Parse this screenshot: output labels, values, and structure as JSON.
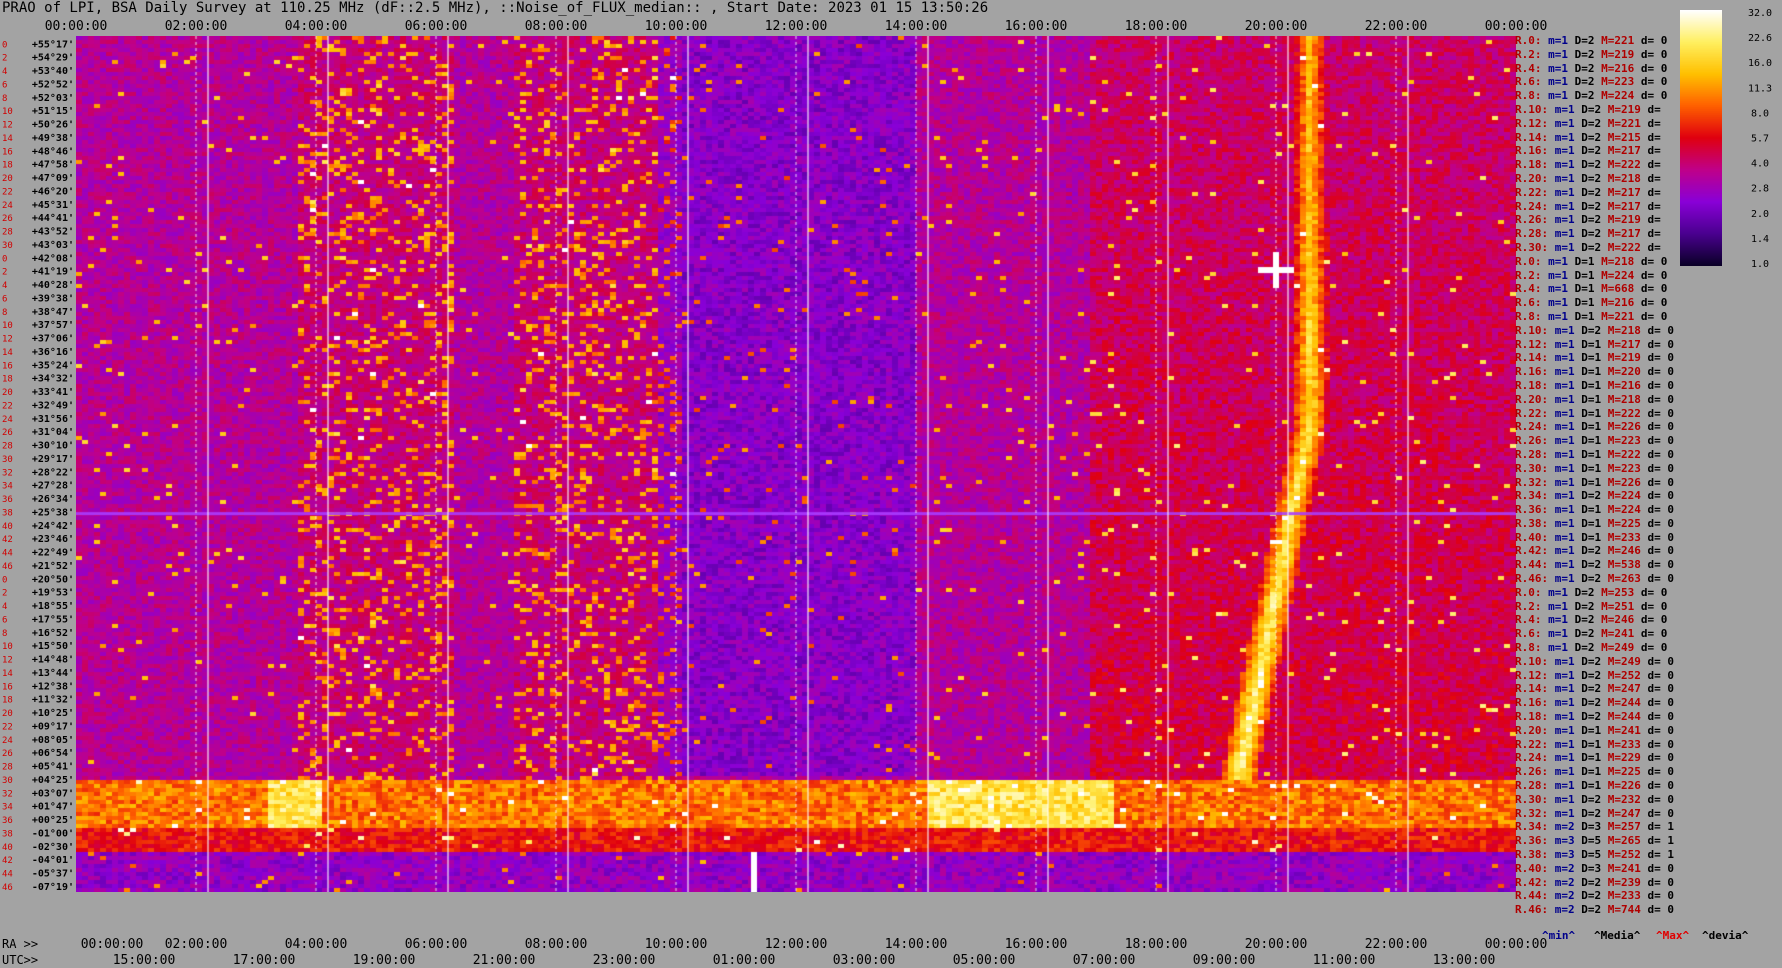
{
  "title": "PRAO of LPI, BSA Daily Survey at 110.25 MHz (dF::2.5 MHz), ::Noise_of_FLUX_median:: , Start Date: 2023 01 15 13:50:26",
  "axis": {
    "top_ticks": [
      "00:00:00",
      "02:00:00",
      "04:00:00",
      "06:00:00",
      "08:00:00",
      "10:00:00",
      "12:00:00",
      "14:00:00",
      "16:00:00",
      "18:00:00",
      "20:00:00",
      "22:00:00",
      "00:00:00"
    ],
    "ra_label": "RA >>",
    "ra_ticks": [
      "00:00:00",
      "02:00:00",
      "04:00:00",
      "06:00:00",
      "08:00:00",
      "10:00:00",
      "12:00:00",
      "14:00:00",
      "16:00:00",
      "18:00:00",
      "20:00:00",
      "22:00:00",
      "00:00:00"
    ],
    "utc_label": "UTC>>",
    "utc_ticks": [
      "15:00:00",
      "17:00:00",
      "19:00:00",
      "21:00:00",
      "23:00:00",
      "01:00:00",
      "03:00:00",
      "05:00:00",
      "07:00:00",
      "09:00:00",
      "11:00:00",
      "13:00:00"
    ],
    "row_index": [
      "0",
      "2",
      "4",
      "6",
      "8",
      "10",
      "12",
      "14",
      "16",
      "18",
      "20",
      "22",
      "24",
      "26",
      "28",
      "30",
      "0",
      "2",
      "4",
      "6",
      "8",
      "10",
      "12",
      "14",
      "16",
      "18",
      "20",
      "22",
      "24",
      "26",
      "28",
      "30",
      "32",
      "34",
      "36",
      "38",
      "40",
      "42",
      "44",
      "46",
      "0",
      "2",
      "4",
      "6",
      "8",
      "10",
      "12",
      "14",
      "16",
      "18",
      "20",
      "22",
      "24",
      "26",
      "28",
      "30",
      "32",
      "34",
      "36",
      "38",
      "40",
      "42",
      "44",
      "46"
    ],
    "dec_labels": [
      "+55°17'",
      "+54°29'",
      "+53°40'",
      "+52°52'",
      "+52°03'",
      "+51°15'",
      "+50°26'",
      "+49°38'",
      "+48°46'",
      "+47°58'",
      "+47°09'",
      "+46°20'",
      "+45°31'",
      "+44°41'",
      "+43°52'",
      "+43°03'",
      "+42°08'",
      "+41°19'",
      "+40°28'",
      "+39°38'",
      "+38°47'",
      "+37°57'",
      "+37°06'",
      "+36°16'",
      "+35°24'",
      "+34°32'",
      "+33°41'",
      "+32°49'",
      "+31°56'",
      "+31°04'",
      "+30°10'",
      "+29°17'",
      "+28°22'",
      "+27°28'",
      "+26°34'",
      "+25°38'",
      "+24°42'",
      "+23°46'",
      "+22°49'",
      "+21°52'",
      "+20°50'",
      "+19°53'",
      "+18°55'",
      "+17°55'",
      "+16°52'",
      "+15°50'",
      "+14°48'",
      "+13°44'",
      "+12°38'",
      "+11°32'",
      "+10°25'",
      "+09°17'",
      "+08°05'",
      "+06°54'",
      "+05°41'",
      "+04°25'",
      "+03°07'",
      "+01°47'",
      "+00°25'",
      "-01°00'",
      "-02°30'",
      "-04°01'",
      "-05°37'",
      "-07°19'"
    ]
  },
  "colorbar": {
    "ticks": [
      "32.0",
      "22.6",
      "16.0",
      "11.3",
      "8.0",
      "5.7",
      "4.0",
      "2.8",
      "2.0",
      "1.4",
      "1.0"
    ],
    "colors": [
      "#ffffff",
      "#fff060",
      "#ffc000",
      "#ff6000",
      "#e00010",
      "#c0008a",
      "#8a00d8",
      "#4a0090",
      "#0c0028"
    ]
  },
  "stats": [
    {
      "r": "R.0:",
      "m": "1",
      "D": "2",
      "M": "221",
      "d": "0"
    },
    {
      "r": "R.2:",
      "m": "1",
      "D": "2",
      "M": "219",
      "d": "0"
    },
    {
      "r": "R.4:",
      "m": "1",
      "D": "2",
      "M": "216",
      "d": "0"
    },
    {
      "r": "R.6:",
      "m": "1",
      "D": "2",
      "M": "223",
      "d": "0"
    },
    {
      "r": "R.8:",
      "m": "1",
      "D": "2",
      "M": "224",
      "d": "0"
    },
    {
      "r": "R.10:",
      "m": "1",
      "D": "2",
      "M": "219",
      "d": ""
    },
    {
      "r": "R.12:",
      "m": "1",
      "D": "2",
      "M": "221",
      "d": ""
    },
    {
      "r": "R.14:",
      "m": "1",
      "D": "2",
      "M": "215",
      "d": ""
    },
    {
      "r": "R.16:",
      "m": "1",
      "D": "2",
      "M": "217",
      "d": ""
    },
    {
      "r": "R.18:",
      "m": "1",
      "D": "2",
      "M": "222",
      "d": ""
    },
    {
      "r": "R.20:",
      "m": "1",
      "D": "2",
      "M": "218",
      "d": ""
    },
    {
      "r": "R.22:",
      "m": "1",
      "D": "2",
      "M": "217",
      "d": ""
    },
    {
      "r": "R.24:",
      "m": "1",
      "D": "2",
      "M": "217",
      "d": ""
    },
    {
      "r": "R.26:",
      "m": "1",
      "D": "2",
      "M": "219",
      "d": ""
    },
    {
      "r": "R.28:",
      "m": "1",
      "D": "2",
      "M": "217",
      "d": ""
    },
    {
      "r": "R.30:",
      "m": "1",
      "D": "2",
      "M": "222",
      "d": ""
    },
    {
      "r": "R.0:",
      "m": "1",
      "D": "1",
      "M": "218",
      "d": "0"
    },
    {
      "r": "R.2:",
      "m": "1",
      "D": "1",
      "M": "224",
      "d": "0"
    },
    {
      "r": "R.4:",
      "m": "1",
      "D": "1",
      "M": "668",
      "d": "0"
    },
    {
      "r": "R.6:",
      "m": "1",
      "D": "1",
      "M": "216",
      "d": "0"
    },
    {
      "r": "R.8:",
      "m": "1",
      "D": "1",
      "M": "221",
      "d": "0"
    },
    {
      "r": "R.10:",
      "m": "1",
      "D": "2",
      "M": "218",
      "d": "0"
    },
    {
      "r": "R.12:",
      "m": "1",
      "D": "1",
      "M": "217",
      "d": "0"
    },
    {
      "r": "R.14:",
      "m": "1",
      "D": "1",
      "M": "219",
      "d": "0"
    },
    {
      "r": "R.16:",
      "m": "1",
      "D": "1",
      "M": "220",
      "d": "0"
    },
    {
      "r": "R.18:",
      "m": "1",
      "D": "1",
      "M": "216",
      "d": "0"
    },
    {
      "r": "R.20:",
      "m": "1",
      "D": "1",
      "M": "218",
      "d": "0"
    },
    {
      "r": "R.22:",
      "m": "1",
      "D": "1",
      "M": "222",
      "d": "0"
    },
    {
      "r": "R.24:",
      "m": "1",
      "D": "1",
      "M": "226",
      "d": "0"
    },
    {
      "r": "R.26:",
      "m": "1",
      "D": "1",
      "M": "223",
      "d": "0"
    },
    {
      "r": "R.28:",
      "m": "1",
      "D": "1",
      "M": "222",
      "d": "0"
    },
    {
      "r": "R.30:",
      "m": "1",
      "D": "1",
      "M": "223",
      "d": "0"
    },
    {
      "r": "R.32:",
      "m": "1",
      "D": "1",
      "M": "226",
      "d": "0"
    },
    {
      "r": "R.34:",
      "m": "1",
      "D": "2",
      "M": "224",
      "d": "0"
    },
    {
      "r": "R.36:",
      "m": "1",
      "D": "1",
      "M": "224",
      "d": "0"
    },
    {
      "r": "R.38:",
      "m": "1",
      "D": "1",
      "M": "225",
      "d": "0"
    },
    {
      "r": "R.40:",
      "m": "1",
      "D": "1",
      "M": "233",
      "d": "0"
    },
    {
      "r": "R.42:",
      "m": "1",
      "D": "2",
      "M": "246",
      "d": "0"
    },
    {
      "r": "R.44:",
      "m": "1",
      "D": "2",
      "M": "538",
      "d": "0"
    },
    {
      "r": "R.46:",
      "m": "1",
      "D": "2",
      "M": "263",
      "d": "0"
    },
    {
      "r": "R.0:",
      "m": "1",
      "D": "2",
      "M": "253",
      "d": "0"
    },
    {
      "r": "R.2:",
      "m": "1",
      "D": "2",
      "M": "251",
      "d": "0"
    },
    {
      "r": "R.4:",
      "m": "1",
      "D": "2",
      "M": "246",
      "d": "0"
    },
    {
      "r": "R.6:",
      "m": "1",
      "D": "2",
      "M": "241",
      "d": "0"
    },
    {
      "r": "R.8:",
      "m": "1",
      "D": "2",
      "M": "249",
      "d": "0"
    },
    {
      "r": "R.10:",
      "m": "1",
      "D": "2",
      "M": "249",
      "d": "0"
    },
    {
      "r": "R.12:",
      "m": "1",
      "D": "2",
      "M": "252",
      "d": "0"
    },
    {
      "r": "R.14:",
      "m": "1",
      "D": "2",
      "M": "247",
      "d": "0"
    },
    {
      "r": "R.16:",
      "m": "1",
      "D": "2",
      "M": "244",
      "d": "0"
    },
    {
      "r": "R.18:",
      "m": "1",
      "D": "2",
      "M": "244",
      "d": "0"
    },
    {
      "r": "R.20:",
      "m": "1",
      "D": "1",
      "M": "241",
      "d": "0"
    },
    {
      "r": "R.22:",
      "m": "1",
      "D": "1",
      "M": "233",
      "d": "0"
    },
    {
      "r": "R.24:",
      "m": "1",
      "D": "1",
      "M": "229",
      "d": "0"
    },
    {
      "r": "R.26:",
      "m": "1",
      "D": "1",
      "M": "225",
      "d": "0"
    },
    {
      "r": "R.28:",
      "m": "1",
      "D": "1",
      "M": "226",
      "d": "0"
    },
    {
      "r": "R.30:",
      "m": "1",
      "D": "2",
      "M": "232",
      "d": "0"
    },
    {
      "r": "R.32:",
      "m": "1",
      "D": "2",
      "M": "247",
      "d": "0"
    },
    {
      "r": "R.34:",
      "m": "2",
      "D": "3",
      "M": "257",
      "d": "1"
    },
    {
      "r": "R.36:",
      "m": "3",
      "D": "5",
      "M": "265",
      "d": "1"
    },
    {
      "r": "R.38:",
      "m": "3",
      "D": "5",
      "M": "252",
      "d": "1"
    },
    {
      "r": "R.40:",
      "m": "2",
      "D": "3",
      "M": "241",
      "d": "0"
    },
    {
      "r": "R.42:",
      "m": "2",
      "D": "2",
      "M": "239",
      "d": "0"
    },
    {
      "r": "R.44:",
      "m": "2",
      "D": "2",
      "M": "233",
      "d": "0"
    },
    {
      "r": "R.46:",
      "m": "2",
      "D": "2",
      "M": "744",
      "d": "0"
    }
  ],
  "bottom_legend": {
    "min": "^min^",
    "median": "^Media^",
    "max": "^Max^",
    "dev": "^devia^"
  },
  "chart_data": {
    "type": "heatmap",
    "title": "PRAO of LPI, BSA Daily Survey at 110.25 MHz (dF::2.5 MHz), ::Noise_of_FLUX_median:: , Start Date: 2023 01 15 13:50:26",
    "x_axis_top": "RA 00:00:00 to 24:00:00",
    "y_axis": "Declination +55°17' to -07°19'",
    "color_scale": [
      1.0,
      32.0
    ],
    "log_scale": true,
    "features": [
      {
        "desc": "bright horizontal interference band",
        "dec": [
          "+01°47'",
          "-02°30'"
        ],
        "level": 8
      },
      {
        "desc": "strong point source",
        "ra": "20:00:00",
        "dec": "+41°19'",
        "level": 32
      },
      {
        "desc": "Galactic plane ridge",
        "ra": [
          "18:00:00",
          "20:10:00"
        ],
        "level": 8
      },
      {
        "desc": "horizontal artifact line",
        "dec": "+25°38'",
        "level": 2.8
      }
    ]
  }
}
